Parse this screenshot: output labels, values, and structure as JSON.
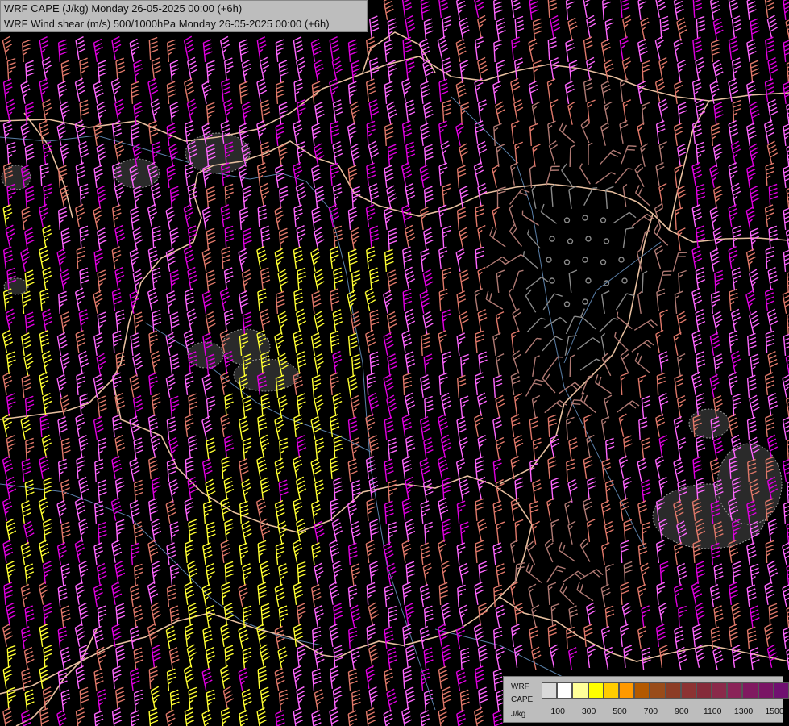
{
  "header": {
    "title_line1": "WRF CAPE (J/kg) Monday 26-05-2025 00:00 (+6h)",
    "title_line2": "WRF Wind shear (m/s) 500/1000hPa Monday 26-05-2025 00:00 (+6h)"
  },
  "legend": {
    "model_label": "WRF",
    "variable_label": "CAPE",
    "unit_label": "J/kg",
    "colors": [
      "#d9d9d9",
      "#ffffff",
      "#ffff99",
      "#ffff00",
      "#ffcc00",
      "#ff9900",
      "#b35900",
      "#994c1a",
      "#8c3d26",
      "#8c3333",
      "#852b3a",
      "#8a2a4a",
      "#8a2358",
      "#801a60",
      "#7a1565",
      "#701070"
    ],
    "tick_labels": [
      "100",
      "300",
      "500",
      "700",
      "900",
      "1100",
      "1300",
      "1500"
    ]
  },
  "map": {
    "content": "wind shear barbs colored by speed over Hungary region",
    "barb_colors": {
      "calm": "#8a8a8a",
      "weak": "#b07a74",
      "moderate": "#e0786a",
      "strong": "#ff66ff",
      "very_strong": "#e000e0",
      "yellow": "#ffff33"
    },
    "border_color": "#e8c0a0",
    "river_color": "#5a7fa8",
    "cape_contour_color": "#9a9a9a"
  }
}
